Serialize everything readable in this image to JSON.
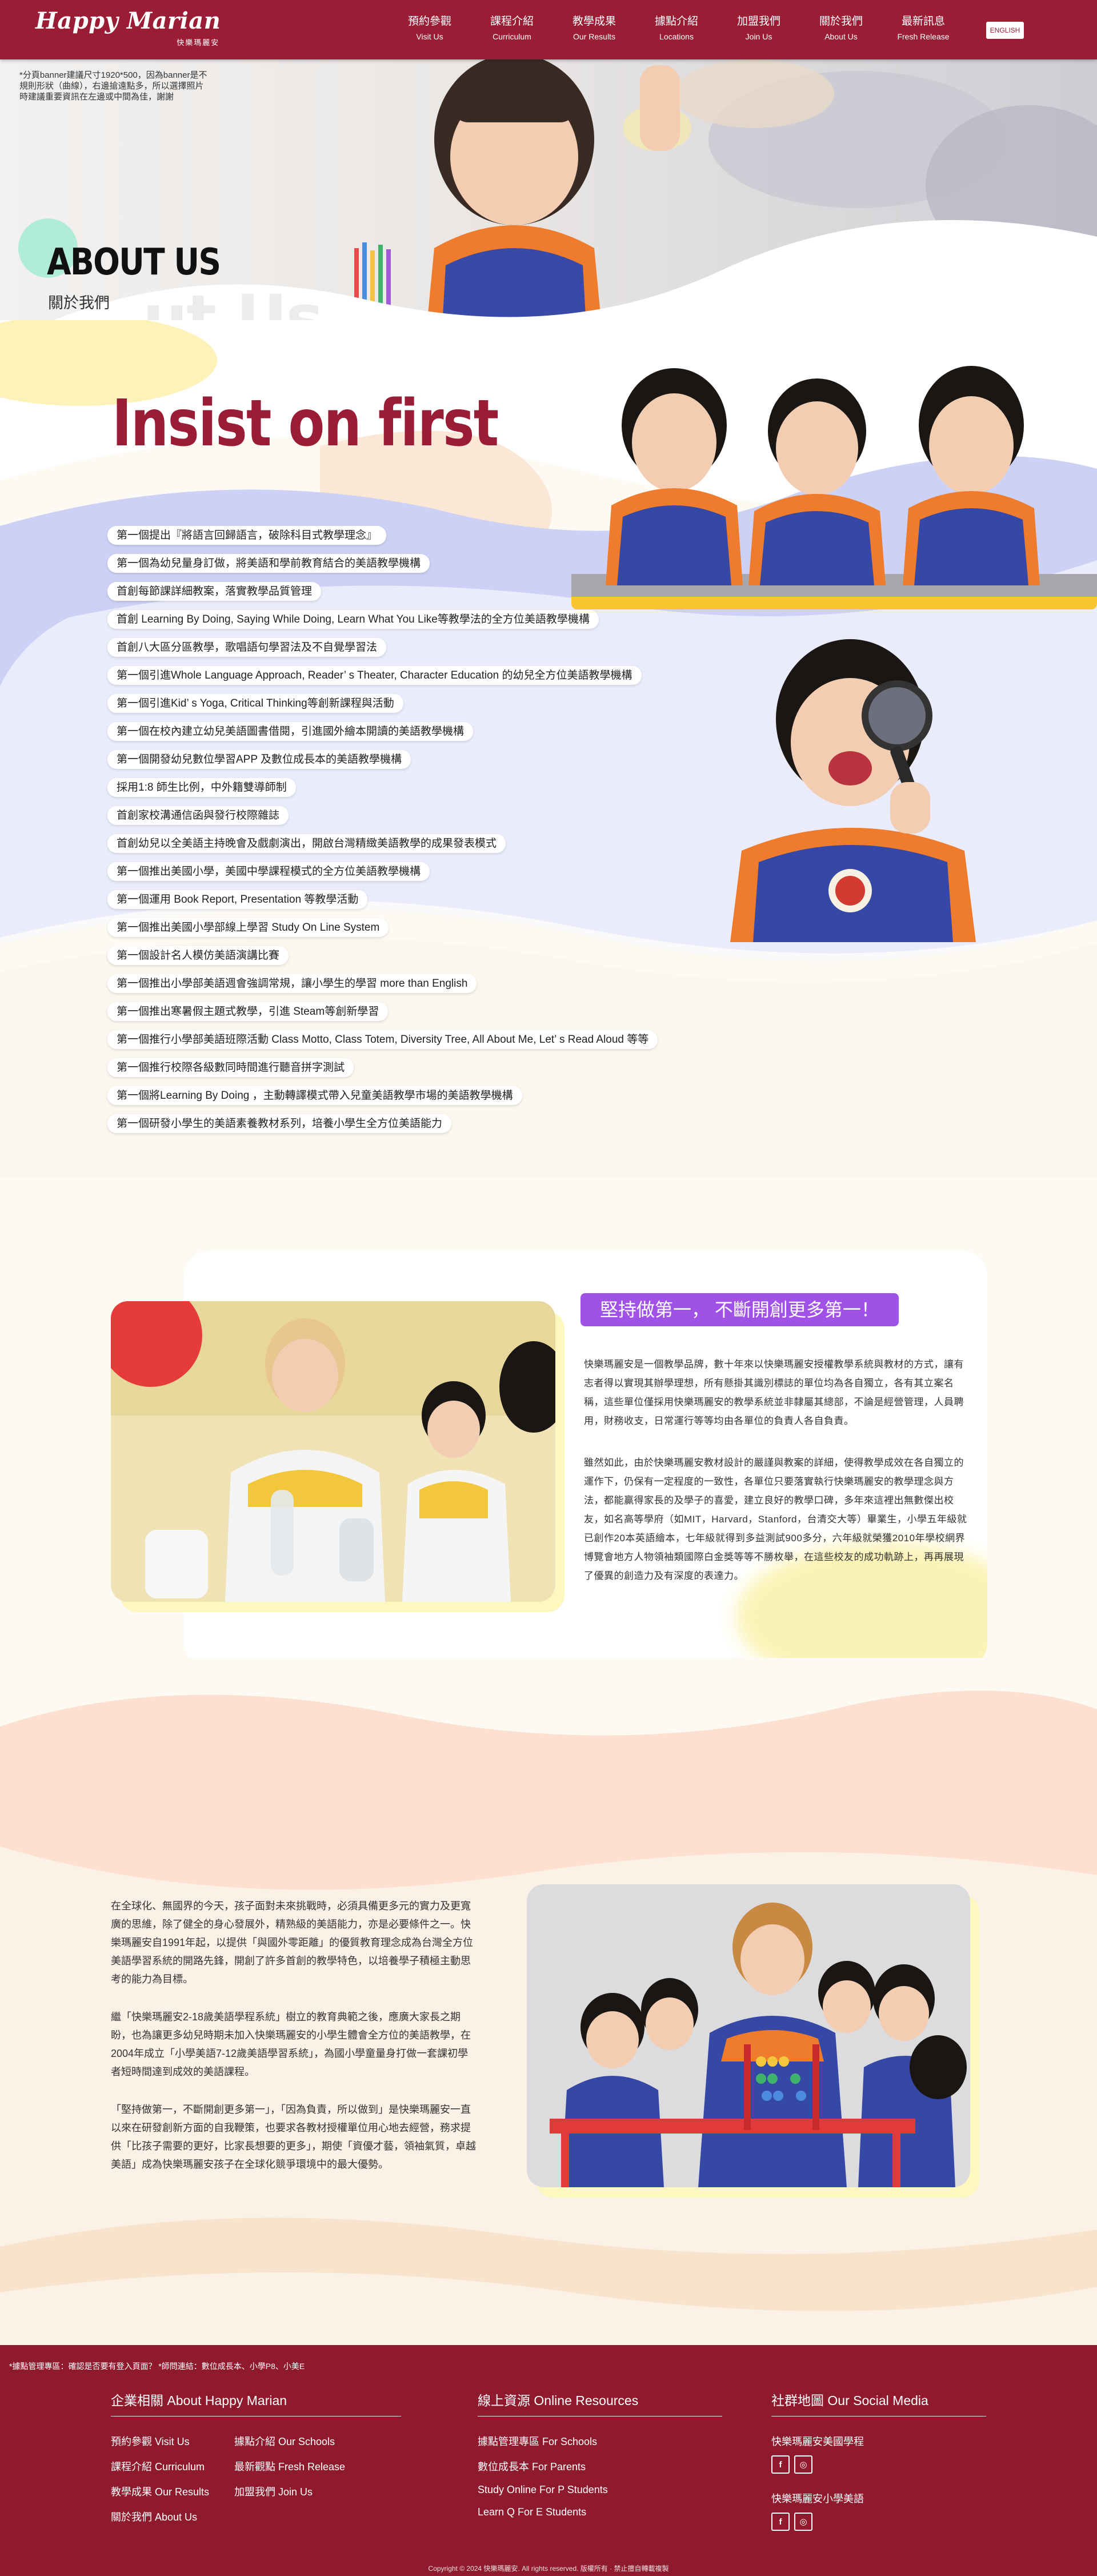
{
  "brand": {
    "name_en": "Happy Marian",
    "name_zh": "快樂瑪麗安"
  },
  "nav": [
    {
      "zh": "預約參觀",
      "en": "Visit Us"
    },
    {
      "zh": "課程介紹",
      "en": "Curriculum"
    },
    {
      "zh": "教學成果",
      "en": "Our Results"
    },
    {
      "zh": "據點介紹",
      "en": "Locations"
    },
    {
      "zh": "加盟我們",
      "en": "Join Us"
    },
    {
      "zh": "關於我們",
      "en": "About Us"
    },
    {
      "zh": "最新訊息",
      "en": "Fresh Release"
    }
  ],
  "lang_button": "ENGLISH",
  "hero": {
    "note": "*分頁banner建議尺寸1920*500，因為banner是不規則形狀（曲線），右邊搶遠點多，所以選擇照片時建議重要資訊在左邊或中間為佳，謝謝",
    "title": "ABOUT US",
    "subtitle": "關於我們",
    "ghost": "ut Us"
  },
  "insist": {
    "title": "Insist on first",
    "items": [
      "第一個提出『將語言回歸語言，破除科目式教學理念』",
      "第一個為幼兒量身訂做，將美語和學前教育結合的美語教學機構",
      "首創每節課詳細教案，落實教學品質管理",
      "首創 Learning By Doing, Saying While Doing, Learn What You Like等教學法的全方位美語教學機構",
      "首創八大區分區教學，歌唱語句學習法及不自覺學習法",
      "第一個引進Whole Language Approach, Reader’ s Theater, Character Education 的幼兒全方位美語教學機構",
      "第一個引進Kid’ s Yoga, Critical Thinking等創新課程與活動",
      "第一個在校內建立幼兒美語圖書借閱，引進國外繪本開讀的美語教學機構",
      "第一個開發幼兒數位學習APP 及數位成長本的美語教學機構",
      "採用1:8 師生比例，中外籍雙導師制",
      "首創家校溝通信函與發行校際雜誌",
      "首創幼兒以全美語主持晚會及戲劇演出，開啟台灣精緻美語教學的成果發表模式",
      "第一個推出美國小學，美國中學課程模式的全方位美語教學機構",
      "第一個運用 Book Report, Presentation 等教學活動",
      "第一個推出美國小學部線上學習 Study On Line System",
      "第一個設計名人模仿美語演講比賽",
      "第一個推出小學部美語週會強調常規，讓小學生的學習 more than English",
      "第一個推出寒暑假主題式教學，引進 Steam等創新學習",
      "第一個推行小學部美語班際活動 Class Motto, Class Totem, Diversity Tree, All About Me, Let’ s Read Aloud 等等",
      "第一個推行校際各級數同時間進行聽音拼字測試",
      "第一個將Learning By Doing ，主動轉譯模式帶入兒童美語教學市場的美語教學機構",
      "第一個研發小學生的美語素養教材系列，培養小學生全方位美語能力"
    ]
  },
  "card": {
    "badge": "堅持做第一，  不斷開創更多第一！",
    "paragraphs": [
      "快樂瑪麗安是一個教學品牌，數十年來以快樂瑪麗安授權教學系統與教材的方式，讓有志者得以實現其辦學理想，所有懸掛其識別標誌的單位均為各自獨立，各有其立案名稱，這些單位僅採用快樂瑪麗安的教學系統並非隸屬其總部，不論是經營管理，人員聘用，財務收支，日常運行等等均由各單位的負責人各自負責。",
      "雖然如此，由於快樂瑪麗安教材設計的嚴謹與教案的詳細，使得教學成效在各自獨立的運作下，仍保有一定程度的一致性，各單位只要落實執行快樂瑪麗安的教學理念與方法，都能贏得家長的及學子的喜愛，建立良好的教學口碑，多年來這裡出無數傑出校友，如名高等學府（如MIT，Harvard，Stanford，台清交大等）畢業生，小學五年級就已創作20本英語繪本，七年級就得到多益測試900多分，六年級就榮獲2010年學校網界博覽會地方人物領袖類國際白金獎等等不勝枚舉，在這些校友的成功軌跡上，再再展現了優異的創造力及有深度的表達力。"
    ]
  },
  "global": {
    "paragraphs": [
      "在全球化、無國界的今天，孩子面對未來挑戰時，必須具備更多元的實力及更寬廣的思維，除了健全的身心發展外，精熟級的美語能力，亦是必要條件之一。快樂瑪麗安自1991年起，以提供「與國外零距離」的優質教育理念成為台灣全方位美語學習系統的開路先鋒，開創了許多首創的教學特色，以培養學子積極主動思考的能力為目標。",
      "繼「快樂瑪麗安2-18歲美語學程系統」樹立的教育典範之後，應廣大家長之期盼，也為讓更多幼兒時期未加入快樂瑪麗安的小學生體會全方位的美語教學，在2004年成立「小學美語7-12歲美語學習系統」，為國小學童量身打做一套課初學者短時間達到成效的美語課程。",
      "「堅持做第一，不斷開創更多第一」，「因為負責，所以做到」是快樂瑪麗安一直以來在研發創新方面的自我鞭策，也要求各教材授權單位用心地去經營，務求提供「比孩子需要的更好，比家長想要的更多」，期使「資優才藝，領袖氣質，卓越美語」成為快樂瑪麗安孩子在全球化競爭環境中的最大優勢。"
    ]
  },
  "footer": {
    "note": "*據點管理專區：確認是否要有登入頁面？ *師問連結：數位成長本、小學P8、小美E",
    "col1": {
      "title": "企業相關 About Happy Marian",
      "links": [
        "預約參觀  Visit Us",
        "據點介紹  Our Schools",
        "課程介紹  Curriculum",
        "最新觀點  Fresh Release",
        "教學成果  Our Results",
        "加盟我們  Join Us",
        "關於我們  About Us"
      ]
    },
    "col2": {
      "title": "線上資源 Online Resources",
      "links": [
        "據點管理專區  For Schools",
        "數位成長本  For Parents",
        "Study Online  For P Students",
        "Learn Q  For E Students"
      ]
    },
    "col3": {
      "title": "社群地圖 Our Social Media",
      "groups": [
        "快樂瑪麗安美國學程",
        "快樂瑪麗安小學美語"
      ]
    },
    "copyright": "Copyright © 2024 快樂瑪麗安. All rights reserved. 版權所有 · 禁止擅自轉載複製"
  },
  "colors": {
    "brand": "#9b1c35",
    "badge": "#a052e6",
    "footer": "#8f1a2d",
    "lavender": "#ccd1f5",
    "cream": "#fbf1e7"
  }
}
